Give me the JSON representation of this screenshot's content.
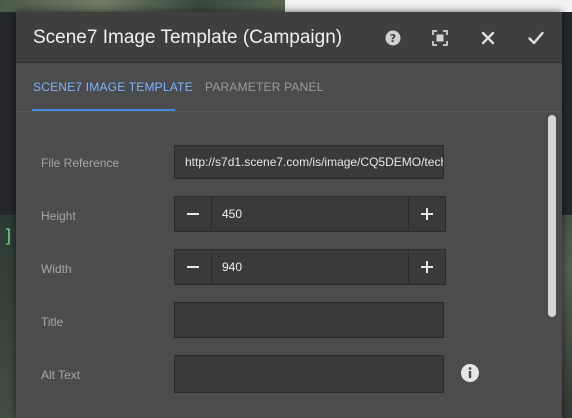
{
  "dialog": {
    "title": "Scene7 Image Template (Campaign)",
    "buttons": {
      "help": "help-icon",
      "fullscreen": "fullscreen-icon",
      "close": "close-icon",
      "done": "checkmark-icon"
    }
  },
  "tabs": [
    {
      "label": "SCENE7 IMAGE TEMPLATE",
      "active": true
    },
    {
      "label": "PARAMETER PANEL",
      "active": false
    }
  ],
  "form": {
    "file_reference": {
      "label": "File Reference",
      "value": "http://s7d1.scene7.com/is/image/CQ5DEMO/tech"
    },
    "height": {
      "label": "Height",
      "value": "450"
    },
    "width": {
      "label": "Width",
      "value": "940"
    },
    "title": {
      "label": "Title",
      "value": ""
    },
    "alt_text": {
      "label": "Alt Text",
      "value": ""
    }
  },
  "colors": {
    "accent": "#3d8de0",
    "dialog_bg": "#4c4c4c",
    "title_bar": "#3f3f3f"
  }
}
